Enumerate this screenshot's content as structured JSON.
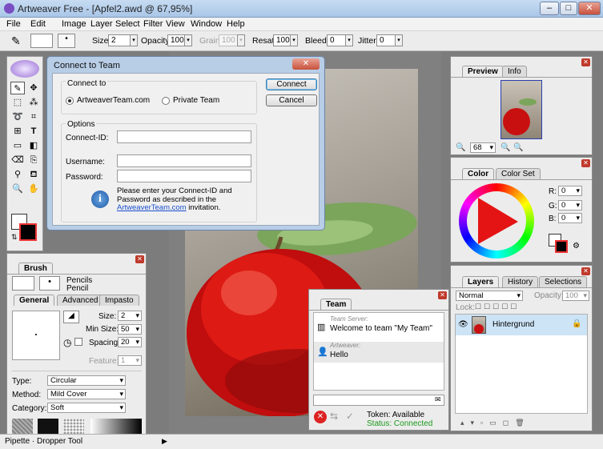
{
  "window": {
    "title": "Artweaver Free - [Apfel2.awd @ 67,95%]",
    "minimize": "–",
    "maximize": "□",
    "close": "✕"
  },
  "menu": [
    "File",
    "Edit",
    "Image",
    "Layer",
    "Select",
    "Filter",
    "View",
    "Window",
    "Help"
  ],
  "toolbar": {
    "size_label": "Size:",
    "size_value": "2",
    "opacity_label": "Opacity:",
    "opacity_value": "100",
    "grain_label": "Grain:",
    "grain_value": "100",
    "resat_label": "Resat:",
    "resat_value": "100",
    "bleed_label": "Bleed:",
    "bleed_value": "0",
    "jitter_label": "Jitter:",
    "jitter_value": "0"
  },
  "dialog": {
    "title": "Connect to Team",
    "connect_to_label": "Connect to",
    "radio_artweaver": "ArtweaverTeam.com",
    "radio_private": "Private Team",
    "connect_button": "Connect",
    "cancel_button": "Cancel",
    "options_label": "Options",
    "connect_id_label": "Connect-ID:",
    "username_label": "Username:",
    "password_label": "Password:",
    "info_text": "Please enter your Connect-ID and Password as described in the",
    "info_link": "ArtweaverTeam.com",
    "info_text_end": "invitation."
  },
  "preview": {
    "tabs": [
      "Preview",
      "Info"
    ],
    "zoom": "68"
  },
  "color": {
    "tabs": [
      "Color",
      "Color Set"
    ],
    "r_label": "R:",
    "r": "0",
    "g_label": "G:",
    "g": "0",
    "b_label": "B:",
    "b": "0"
  },
  "layers": {
    "tabs": [
      "Layers",
      "History",
      "Selections"
    ],
    "blend_mode": "Normal",
    "opacity_label": "Opacity:",
    "opacity": "100",
    "lock_label": "Lock:",
    "layer_name": "Hintergrund"
  },
  "brush": {
    "title": "Brush",
    "category_line1": "Pencils",
    "category_line2": "Pencil",
    "tabs": [
      "General",
      "Advanced",
      "Impasto"
    ],
    "size_label": "Size:",
    "size": "2",
    "min_size_label": "Min Size:",
    "min_size": "50",
    "spacing_label": "Spacing:",
    "spacing": "20",
    "feature_label": "Feature:",
    "feature": "1",
    "type_label": "Type:",
    "type": "Circular",
    "method_label": "Method:",
    "method": "Mild Cover",
    "category_label": "Category:",
    "category": "Soft"
  },
  "team": {
    "tab": "Team",
    "server_meta": "Team Server:",
    "server_msg": "Welcome to team \"My Team\"",
    "user_meta": "Artweaver:",
    "user_msg": "Hello",
    "token": "Token: Available",
    "status": "Status: Connected",
    "status_color": "#1a9a1a"
  },
  "statusbar": {
    "text": "Pipette · Dropper Tool"
  }
}
